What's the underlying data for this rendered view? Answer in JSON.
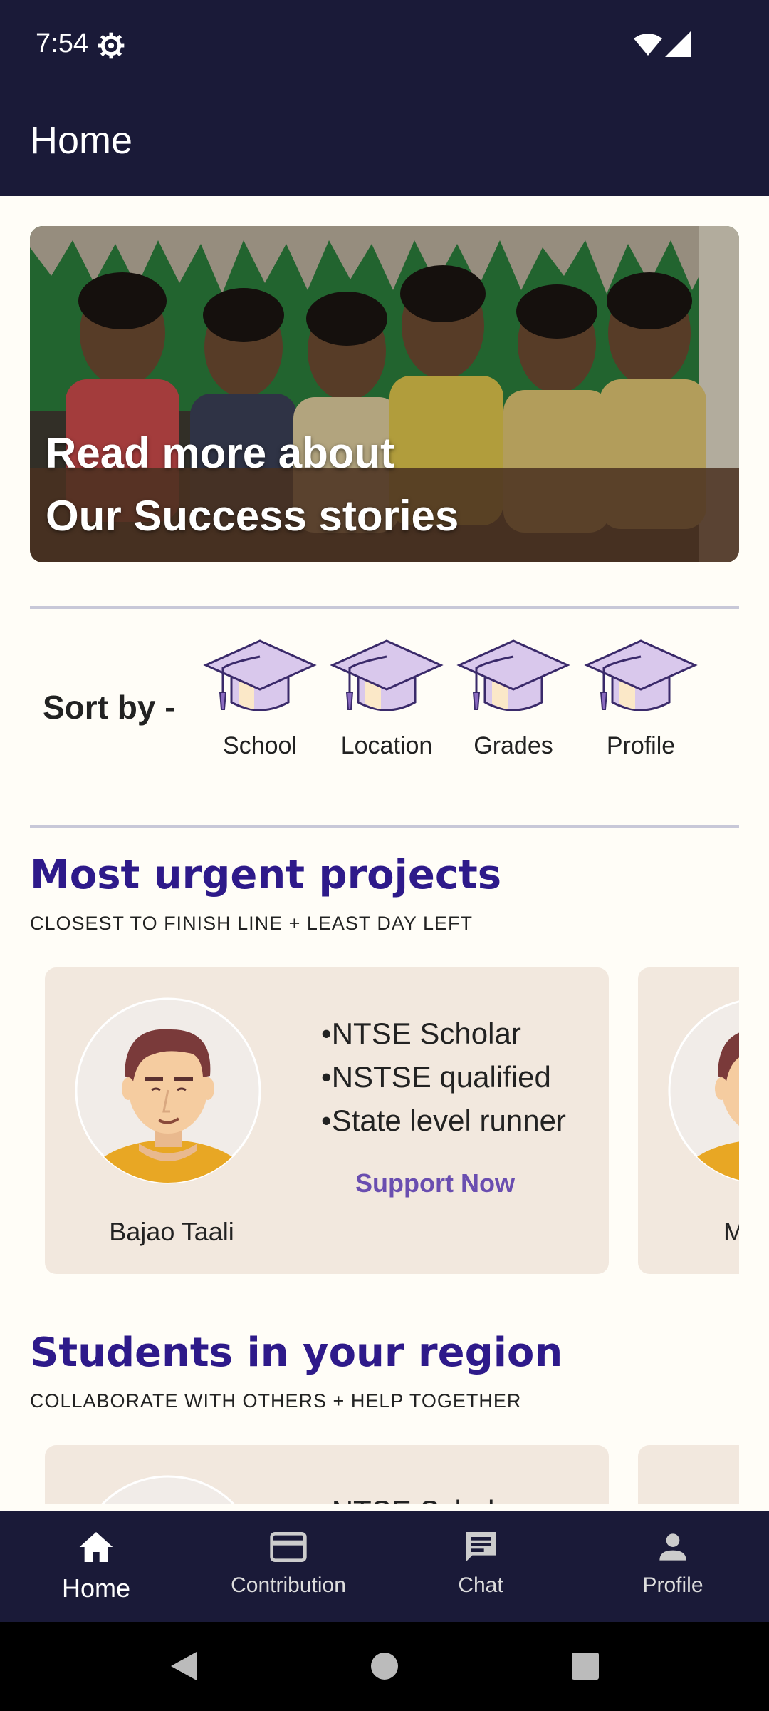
{
  "status_bar": {
    "time": "7:54"
  },
  "app_bar": {
    "title": "Home"
  },
  "banner": {
    "line1": "Read more about",
    "line2": "Our Success stories"
  },
  "sort": {
    "label": "Sort by -",
    "options": [
      {
        "label": "School",
        "icon": "graduation-cap-icon"
      },
      {
        "label": "Location",
        "icon": "graduation-cap-icon"
      },
      {
        "label": "Grades",
        "icon": "graduation-cap-icon"
      },
      {
        "label": "Profile",
        "icon": "graduation-cap-icon"
      }
    ]
  },
  "urgent": {
    "title": "Most urgent projects",
    "subtitle": "CLOSEST TO FINISH LINE + LEAST DAY LEFT",
    "cards": [
      {
        "name": "Bajao Taali",
        "achievements": [
          "NTSE Scholar",
          "NSTSE qualified",
          "State level runner"
        ],
        "action": "Support Now"
      }
    ],
    "peek_name": "M"
  },
  "region": {
    "title": "Students in your region",
    "subtitle": "COLLABORATE WITH OTHERS + HELP TOGETHER",
    "cards": [
      {
        "achievements": [
          "NTSE Scholar"
        ]
      }
    ]
  },
  "bottom_nav": [
    {
      "label": "Home",
      "icon": "home-icon",
      "active": true
    },
    {
      "label": "Contribution",
      "icon": "card-icon",
      "active": false
    },
    {
      "label": "Chat",
      "icon": "chat-icon",
      "active": false
    },
    {
      "label": "Profile",
      "icon": "person-icon",
      "active": false
    }
  ],
  "colors": {
    "header": "#1a1a38",
    "accent": "#2e1a8a",
    "card": "#f2e8de",
    "link": "#6a4eb0"
  }
}
